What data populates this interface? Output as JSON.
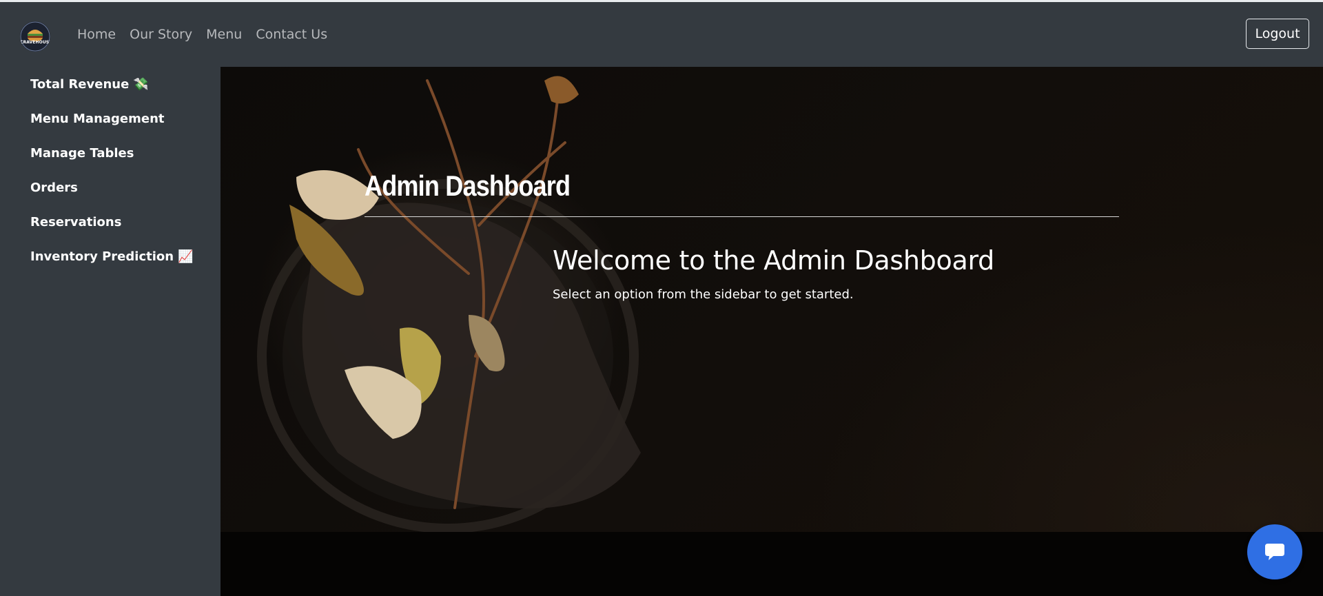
{
  "brand": {
    "logo_text": "CRAVEHOUSE",
    "logo_icon": "burger-logo"
  },
  "nav": {
    "links": [
      "Home",
      "Our Story",
      "Menu",
      "Contact Us"
    ],
    "logout_label": "Logout"
  },
  "sidebar": {
    "items": [
      {
        "label": "Total Revenue",
        "emoji": "💸"
      },
      {
        "label": "Menu Management",
        "emoji": ""
      },
      {
        "label": "Manage Tables",
        "emoji": ""
      },
      {
        "label": "Orders",
        "emoji": ""
      },
      {
        "label": "Reservations",
        "emoji": ""
      },
      {
        "label": "Inventory Prediction",
        "emoji": "📈"
      }
    ]
  },
  "main": {
    "title": "Admin Dashboard",
    "welcome_heading": "Welcome to the Admin Dashboard",
    "welcome_text": "Select an option from the sidebar to get started."
  },
  "chat": {
    "icon": "chat-bubble-icon"
  },
  "colors": {
    "navbar_bg": "#343a40",
    "sidebar_bg": "#343a40",
    "nav_link": "#b7b9bc",
    "chat_button": "#2f6fe4"
  }
}
